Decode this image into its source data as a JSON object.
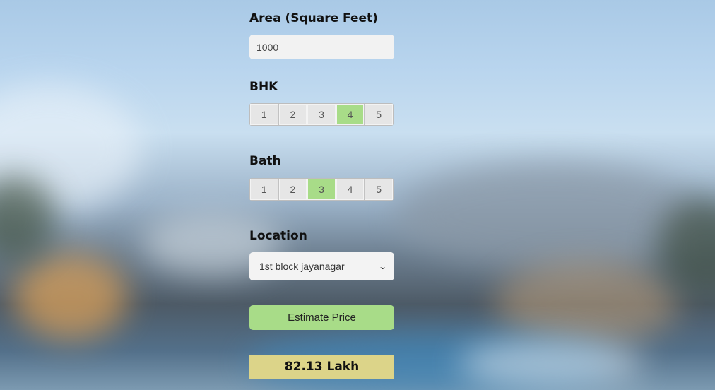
{
  "area": {
    "label": "Area (Square Feet)",
    "value": "1000"
  },
  "bhk": {
    "label": "BHK",
    "options": [
      "1",
      "2",
      "3",
      "4",
      "5"
    ],
    "selected": "4"
  },
  "bath": {
    "label": "Bath",
    "options": [
      "1",
      "2",
      "3",
      "4",
      "5"
    ],
    "selected": "3"
  },
  "location": {
    "label": "Location",
    "selected": "1st block jayanagar"
  },
  "estimate_button": {
    "label": "Estimate Price"
  },
  "result": {
    "text": "82.13 Lakh"
  },
  "colors": {
    "selected_green": "#a8dc88",
    "result_yellow": "#dcd489"
  }
}
